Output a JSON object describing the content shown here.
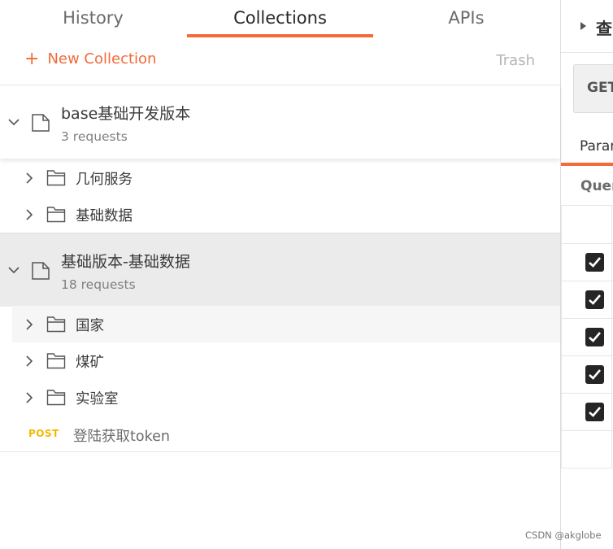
{
  "tabs": [
    {
      "label": "History",
      "active": false
    },
    {
      "label": "Collections",
      "active": true
    },
    {
      "label": "APIs",
      "active": false
    }
  ],
  "actions": {
    "new_collection_label": "New Collection",
    "trash_label": "Trash"
  },
  "collections": [
    {
      "name": "base基础开发版本",
      "count": "3 requests",
      "folders": [
        {
          "name": "几何服务"
        },
        {
          "name": "基础数据"
        }
      ]
    },
    {
      "name": "基础版本-基础数据",
      "count": "18 requests",
      "folders": [
        {
          "name": "国家"
        },
        {
          "name": "煤矿"
        },
        {
          "name": "实验室"
        }
      ],
      "requests": [
        {
          "method": "POST",
          "name": "登陆获取token"
        }
      ]
    }
  ],
  "right_panel": {
    "title": "查",
    "method": "GET",
    "tab": "Params",
    "sub_label": "Query"
  },
  "watermark": "CSDN @akglobe",
  "colors": {
    "accent": "#f26b3a",
    "post_method": "#f5b800"
  }
}
